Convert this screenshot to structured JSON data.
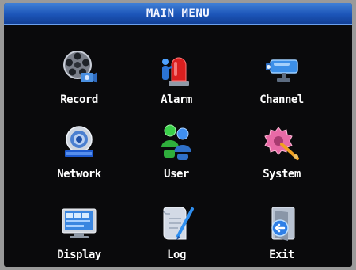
{
  "header": {
    "title": "MAIN MENU"
  },
  "menu": {
    "items": [
      {
        "label": "Record",
        "icon": "film-reel-camera-icon"
      },
      {
        "label": "Alarm",
        "icon": "siren-person-icon"
      },
      {
        "label": "Channel",
        "icon": "cctv-camera-icon"
      },
      {
        "label": "Network",
        "icon": "internet-globe-icon"
      },
      {
        "label": "User",
        "icon": "users-icon"
      },
      {
        "label": "System",
        "icon": "system-gear-icon"
      },
      {
        "label": "Display",
        "icon": "monitor-display-icon"
      },
      {
        "label": "Log",
        "icon": "log-document-pen-icon"
      },
      {
        "label": "Exit",
        "icon": "exit-arrow-icon"
      }
    ]
  },
  "colors": {
    "title_bar": "#1c55b8",
    "background": "#0a0a0c",
    "label_text": "#ffffff"
  }
}
